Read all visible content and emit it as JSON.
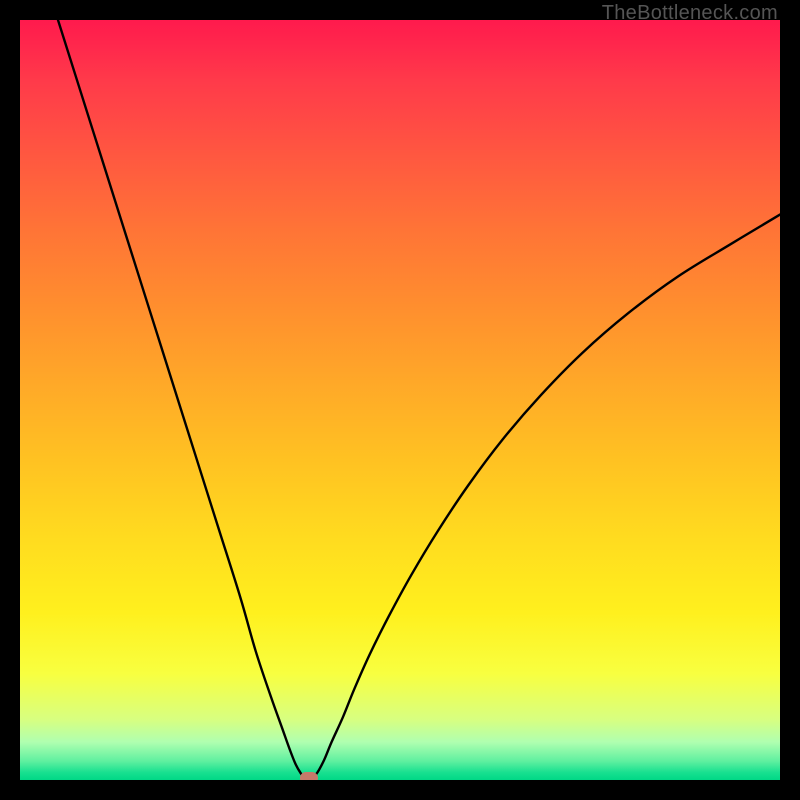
{
  "watermark": "TheBottleneck.com",
  "chart_data": {
    "type": "line",
    "title": "",
    "xlabel": "",
    "ylabel": "",
    "xlim": [
      0,
      100
    ],
    "ylim": [
      0,
      100
    ],
    "series": [
      {
        "name": "bottleneck-curve",
        "x": [
          5,
          8,
          11,
          14,
          17,
          20,
          23,
          26,
          29,
          31,
          33,
          34.5,
          35.5,
          36.3,
          37,
          37.5,
          38,
          39,
          40,
          41,
          42.5,
          44,
          46,
          48.5,
          51.5,
          55,
          59,
          63.5,
          68.5,
          74,
          80,
          86.5,
          93.5,
          100
        ],
        "y": [
          100,
          90.5,
          81,
          71.5,
          62,
          52.5,
          43,
          33.5,
          24,
          17,
          11,
          6.8,
          4,
          2,
          0.8,
          0.2,
          0,
          0.8,
          2.6,
          5,
          8.3,
          12,
          16.5,
          21.5,
          27,
          32.8,
          38.8,
          44.8,
          50.6,
          56.2,
          61.4,
          66.2,
          70.5,
          74.4
        ]
      }
    ],
    "annotations": [
      {
        "name": "optimal-marker",
        "x": 38,
        "y": 0.2,
        "color": "#c77a6a"
      }
    ],
    "gradient_background": {
      "top": "#ff1a4d",
      "mid": "#ffdb1f",
      "bottom": "#00d886"
    }
  }
}
